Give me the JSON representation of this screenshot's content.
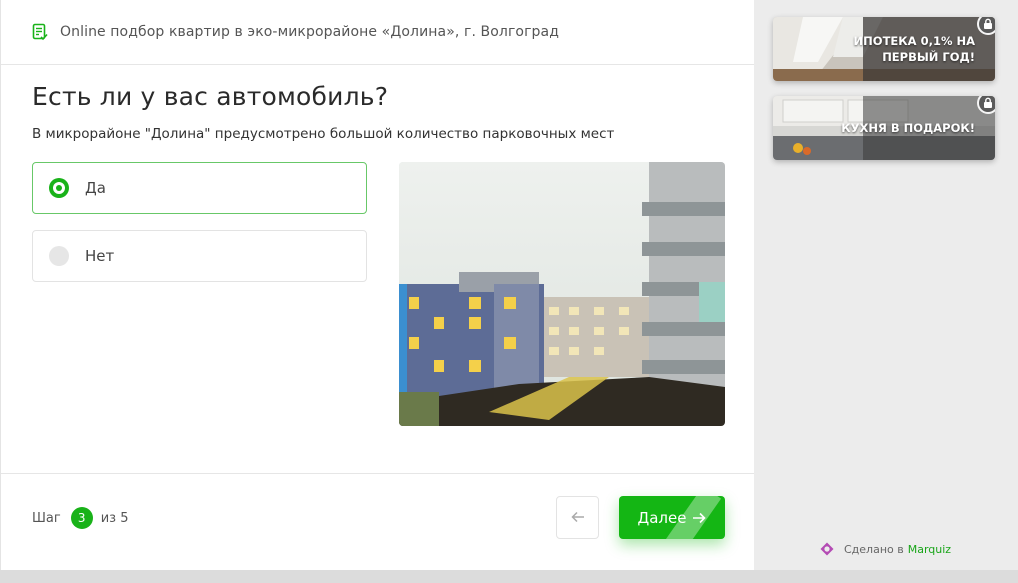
{
  "header": {
    "title": "Online подбор квартир в эко-микрорайоне «Долина», г. Волгоград",
    "icon": "document-check-icon"
  },
  "quiz": {
    "question": "Есть ли у вас автомобиль?",
    "subtitle": "В микрорайоне \"Долина\" предусмотрено большой количество парковочных мест",
    "options": [
      {
        "label": "Да",
        "selected": true
      },
      {
        "label": "Нет",
        "selected": false
      }
    ]
  },
  "footer": {
    "step_prefix": "Шаг",
    "step_current": "3",
    "step_suffix": "из 5",
    "next_label": "Далее"
  },
  "sidebar": {
    "bonuses": [
      {
        "line1": "ИПОТЕКА 0,1% НА",
        "line2": "ПЕРВЫЙ ГОД!",
        "icon": "lock-icon"
      },
      {
        "line1": "КУХНЯ В ПОДАРОК!",
        "icon": "lock-icon"
      }
    ],
    "made_with": "Сделано в",
    "brand": "Marquiz"
  },
  "colors": {
    "accent": "#14b614",
    "selected_border": "#68c868"
  }
}
